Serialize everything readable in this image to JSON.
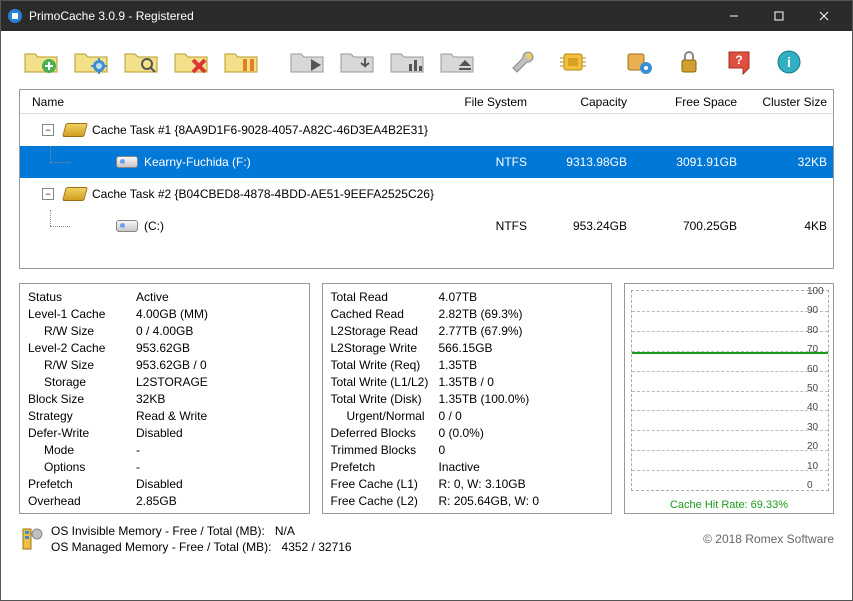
{
  "window": {
    "title": "PrimoCache 3.0.9 - Registered"
  },
  "toolbar_icons": [
    "add-cache-icon",
    "config-cache-icon",
    "inspect-cache-icon",
    "delete-cache-icon",
    "pause-cache-icon",
    "resume-cache-icon",
    "flush-cache-icon",
    "stats-cache-icon",
    "eject-cache-icon",
    "tools-icon",
    "cpu-icon",
    "settings-icon",
    "lock-icon",
    "help-icon",
    "info-icon"
  ],
  "tree": {
    "headers": {
      "name": "Name",
      "fs": "File System",
      "cap": "Capacity",
      "free": "Free Space",
      "cluster": "Cluster Size"
    },
    "tasks": [
      {
        "label": "Cache Task #1 {8AA9D1F6-9028-4057-A82C-46D3EA4B2E31}",
        "volumes": [
          {
            "name": "Kearny-Fuchida (F:)",
            "fs": "NTFS",
            "cap": "9313.98GB",
            "free": "3091.91GB",
            "cluster": "32KB",
            "selected": true
          }
        ]
      },
      {
        "label": "Cache Task #2 {B04CBED8-4878-4BDD-AE51-9EEFA2525C26}",
        "volumes": [
          {
            "name": "(C:)",
            "fs": "NTFS",
            "cap": "953.24GB",
            "free": "700.25GB",
            "cluster": "4KB",
            "selected": false
          }
        ]
      }
    ]
  },
  "stats_left": [
    {
      "k": "Status",
      "v": "Active"
    },
    {
      "k": "Level-1 Cache",
      "v": "4.00GB (MM)"
    },
    {
      "k": "R/W Size",
      "v": "0 / 4.00GB",
      "indent": true
    },
    {
      "k": "Level-2 Cache",
      "v": "953.62GB"
    },
    {
      "k": "R/W Size",
      "v": "953.62GB / 0",
      "indent": true
    },
    {
      "k": "Storage",
      "v": "L2STORAGE",
      "indent": true
    },
    {
      "k": "Block Size",
      "v": "32KB"
    },
    {
      "k": "Strategy",
      "v": "Read & Write"
    },
    {
      "k": "Defer-Write",
      "v": "Disabled"
    },
    {
      "k": "Mode",
      "v": "-",
      "indent": true
    },
    {
      "k": "Options",
      "v": "-",
      "indent": true
    },
    {
      "k": "Prefetch",
      "v": "Disabled"
    },
    {
      "k": "Overhead",
      "v": "2.85GB"
    }
  ],
  "stats_right": [
    {
      "k": "Total Read",
      "v": "4.07TB"
    },
    {
      "k": "Cached Read",
      "v": "2.82TB (69.3%)"
    },
    {
      "k": "L2Storage Read",
      "v": "2.77TB (67.9%)"
    },
    {
      "k": "L2Storage Write",
      "v": "566.15GB"
    },
    {
      "k": "Total Write (Req)",
      "v": "1.35TB"
    },
    {
      "k": "Total Write (L1/L2)",
      "v": "1.35TB / 0"
    },
    {
      "k": "Total Write (Disk)",
      "v": "1.35TB (100.0%)"
    },
    {
      "k": "Urgent/Normal",
      "v": "0 / 0",
      "indent": true
    },
    {
      "k": "Deferred Blocks",
      "v": "0 (0.0%)"
    },
    {
      "k": "Trimmed Blocks",
      "v": "0"
    },
    {
      "k": "Prefetch",
      "v": "Inactive"
    },
    {
      "k": "Free Cache (L1)",
      "v": "R: 0, W: 3.10GB"
    },
    {
      "k": "Free Cache (L2)",
      "v": "R: 205.64GB, W: 0"
    }
  ],
  "chart_data": {
    "type": "line",
    "ylim": [
      0,
      100
    ],
    "yticks": [
      0,
      10,
      20,
      30,
      40,
      50,
      60,
      70,
      80,
      90,
      100
    ],
    "current_pct": 69.33,
    "caption": "Cache Hit Rate: 69.33%"
  },
  "footer": {
    "invisible_label": "OS Invisible Memory - Free / Total (MB):",
    "invisible_value": "N/A",
    "managed_label": "OS Managed Memory - Free / Total (MB):",
    "managed_value": "4352 / 32716",
    "copyright": "© 2018 Romex Software"
  }
}
